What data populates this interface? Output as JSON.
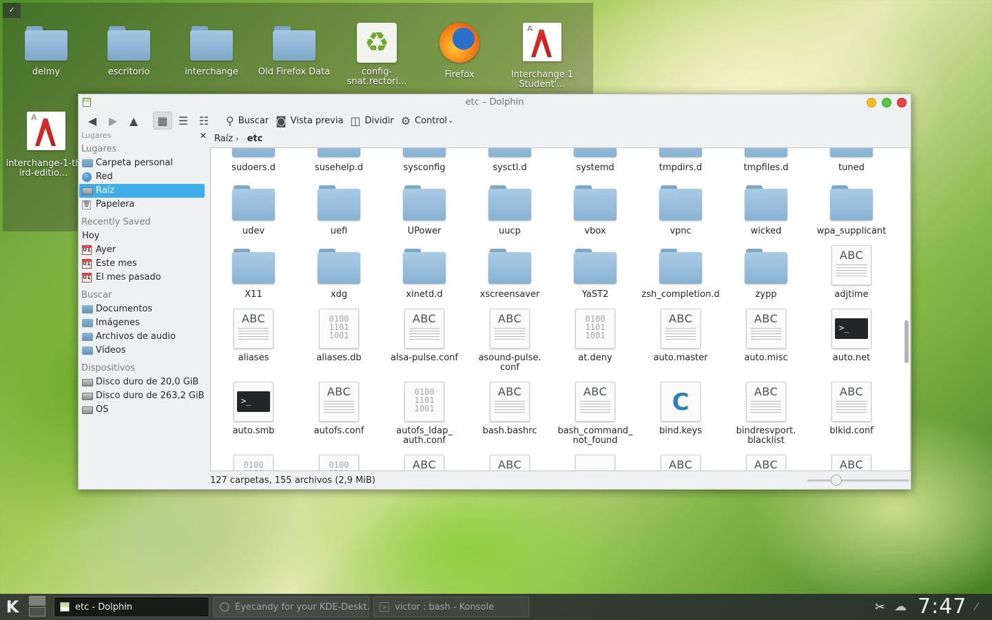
{
  "desktop": {
    "corner_glyph": "✓",
    "icons": [
      {
        "label": "delmy",
        "type": "folder"
      },
      {
        "label": "escritorio",
        "type": "folder"
      },
      {
        "label": "interchange",
        "type": "folder"
      },
      {
        "label": "Old Firefox Data",
        "type": "folder"
      },
      {
        "label": "config-snat.rectori...",
        "type": "recycle"
      },
      {
        "label": "Firefox",
        "type": "firefox"
      },
      {
        "label": "Interchange 1 Student'...",
        "type": "pdf"
      },
      {
        "label": "interchange-1-third-editio...",
        "type": "pdf"
      }
    ]
  },
  "window": {
    "title": "etc – Dolphin",
    "toolbar": {
      "back_icon": "◀",
      "forward_icon": "▶",
      "up_icon": "▲",
      "search_label": "Buscar",
      "preview_label": "Vista previa",
      "split_label": "Dividir",
      "control_label": "Control"
    },
    "sidebar": {
      "dock_title": "Lugares",
      "sections": {
        "places": "Lugares",
        "recent": "Recently Saved",
        "search": "Buscar",
        "devices": "Dispositivos"
      },
      "places": [
        "Carpeta personal",
        "Red",
        "Raíz",
        "Papelera"
      ],
      "recent": [
        "Hoy",
        "Ayer",
        "Este mes",
        "El mes pasado"
      ],
      "search": [
        "Documentos",
        "Imágenes",
        "Archivos de audio",
        "Vídeos"
      ],
      "devices": [
        "Disco duro de 20,0 GiB",
        "Disco duro de 263,2 GiB",
        "OS"
      ],
      "selected": "Raíz",
      "calendar_day": "01"
    },
    "breadcrumb": [
      "Raíz",
      "etc"
    ],
    "files": [
      {
        "name": "sudoers.d",
        "kind": "folder"
      },
      {
        "name": "susehelp.d",
        "kind": "folder"
      },
      {
        "name": "sysconfig",
        "kind": "folder"
      },
      {
        "name": "sysctl.d",
        "kind": "folder"
      },
      {
        "name": "systemd",
        "kind": "folder"
      },
      {
        "name": "tmpdirs.d",
        "kind": "folder"
      },
      {
        "name": "tmpfiles.d",
        "kind": "folder"
      },
      {
        "name": "tuned",
        "kind": "folder"
      },
      {
        "name": "udev",
        "kind": "folder"
      },
      {
        "name": "uefi",
        "kind": "folder"
      },
      {
        "name": "UPower",
        "kind": "folder"
      },
      {
        "name": "uucp",
        "kind": "folder"
      },
      {
        "name": "vbox",
        "kind": "folder"
      },
      {
        "name": "vpnc",
        "kind": "folder"
      },
      {
        "name": "wicked",
        "kind": "folder"
      },
      {
        "name": "wpa_supplicant",
        "kind": "folder"
      },
      {
        "name": "X11",
        "kind": "folder"
      },
      {
        "name": "xdg",
        "kind": "folder"
      },
      {
        "name": "xinetd.d",
        "kind": "folder"
      },
      {
        "name": "xscreensaver",
        "kind": "folder"
      },
      {
        "name": "YaST2",
        "kind": "folder"
      },
      {
        "name": "zsh_completion.d",
        "kind": "folder"
      },
      {
        "name": "zypp",
        "kind": "folder"
      },
      {
        "name": "adjtime",
        "kind": "text"
      },
      {
        "name": "aliases",
        "kind": "text"
      },
      {
        "name": "aliases.db",
        "kind": "binary"
      },
      {
        "name": "alsa-pulse.conf",
        "kind": "text"
      },
      {
        "name": "asound-pulse.\nconf",
        "kind": "text"
      },
      {
        "name": "at.deny",
        "kind": "binary"
      },
      {
        "name": "auto.master",
        "kind": "text"
      },
      {
        "name": "auto.misc",
        "kind": "text"
      },
      {
        "name": "auto.net",
        "kind": "script"
      },
      {
        "name": "auto.smb",
        "kind": "script"
      },
      {
        "name": "autofs.conf",
        "kind": "text"
      },
      {
        "name": "autofs_ldap_\nauth.conf",
        "kind": "binary"
      },
      {
        "name": "bash.bashrc",
        "kind": "text"
      },
      {
        "name": "bash_command_\nnot_found",
        "kind": "text"
      },
      {
        "name": "bind.keys",
        "kind": "csource"
      },
      {
        "name": "bindresvport.\nblacklist",
        "kind": "text"
      },
      {
        "name": "blkid.conf",
        "kind": "text"
      },
      {
        "name": "",
        "kind": "binary"
      },
      {
        "name": "",
        "kind": "binary"
      },
      {
        "name": "",
        "kind": "text"
      },
      {
        "name": "",
        "kind": "text"
      },
      {
        "name": "",
        "kind": "blank"
      },
      {
        "name": "",
        "kind": "text"
      },
      {
        "name": "",
        "kind": "text"
      },
      {
        "name": "",
        "kind": "text"
      }
    ],
    "file_icon_text": {
      "abc": "ABC",
      "bin": "0100\n1101\n1001",
      "prompt": ">_",
      "c": "C"
    },
    "status_text": "127 carpetas, 155 archivos (2,9 MiB)"
  },
  "taskbar": {
    "kmenu_glyph": "K",
    "tasks": [
      {
        "label": "etc - Dolphin",
        "active": true,
        "icon": "dolphin-icon"
      },
      {
        "label": "Eyecandy for your KDE-Deskt...",
        "active": false,
        "icon": "browser-icon"
      },
      {
        "label": "victor : bash - Konsole",
        "active": false,
        "icon": "konsole-icon"
      }
    ],
    "clock": "7:47"
  },
  "colors": {
    "selection": "#3daee9",
    "folder": "#89b2d2",
    "close_button": "#f0403f",
    "max_button": "#4ec73e",
    "min_button": "#f5bc20"
  }
}
